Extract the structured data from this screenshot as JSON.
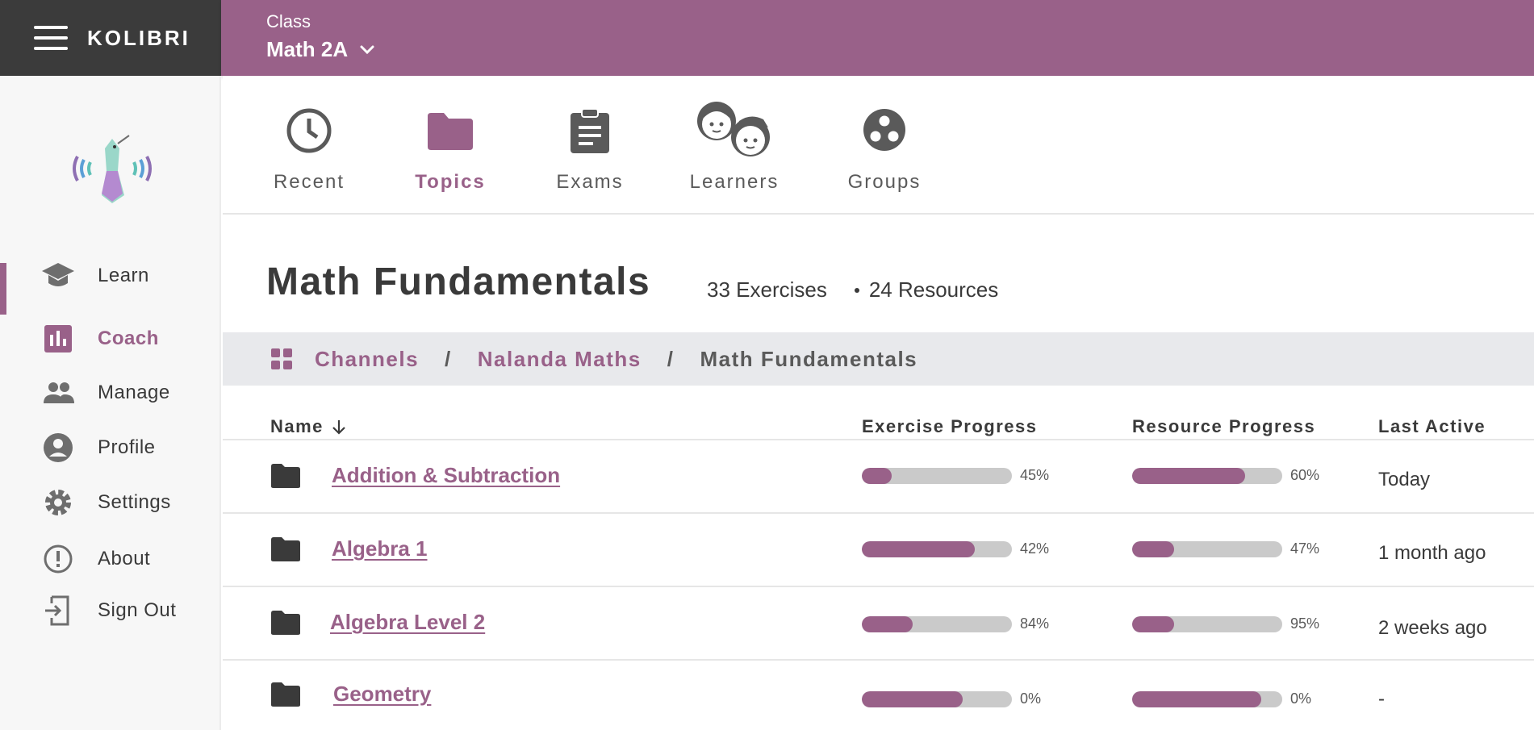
{
  "app": {
    "brand": "KOLIBRI"
  },
  "class": {
    "label": "Class",
    "name": "Math 2A"
  },
  "sidebar": {
    "items": [
      {
        "label": "Learn",
        "icon": "graduation-cap-icon"
      },
      {
        "label": "Coach",
        "icon": "bar-chart-icon",
        "active": true
      },
      {
        "label": "Manage",
        "icon": "people-icon"
      },
      {
        "label": "Profile",
        "icon": "person-circle-icon"
      },
      {
        "label": "Settings",
        "icon": "gear-icon"
      },
      {
        "label": "About",
        "icon": "exclamation-circle-icon"
      },
      {
        "label": "Sign Out",
        "icon": "logout-icon"
      }
    ]
  },
  "tabs": [
    {
      "label": "Recent",
      "icon": "clock-icon"
    },
    {
      "label": "Topics",
      "icon": "folder-icon",
      "active": true
    },
    {
      "label": "Exams",
      "icon": "clipboard-icon"
    },
    {
      "label": "Learners",
      "icon": "learners-faces-icon"
    },
    {
      "label": "Groups",
      "icon": "groups-icon"
    }
  ],
  "header": {
    "title": "Math Fundamentals",
    "exercises": "33 Exercises",
    "resources": "24 Resources"
  },
  "breadcrumb": {
    "root": "Channels",
    "channel": "Nalanda Maths",
    "current": "Math Fundamentals",
    "separator": "/"
  },
  "table": {
    "columns": {
      "name": "Name",
      "exercise_progress": "Exercise Progress",
      "resource_progress": "Resource Progress",
      "last_active": "Last Active"
    },
    "rows": [
      {
        "name": "Addition & Subtraction",
        "exercise_fill": 0.2,
        "exercise_pct": "45%",
        "resource_fill": 0.75,
        "resource_pct": "60%",
        "last_active": "Today"
      },
      {
        "name": "Algebra 1",
        "exercise_fill": 0.75,
        "exercise_pct": "42%",
        "resource_fill": 0.28,
        "resource_pct": "47%",
        "last_active": "1 month ago"
      },
      {
        "name": "Algebra Level 2",
        "exercise_fill": 0.34,
        "exercise_pct": "84%",
        "resource_fill": 0.28,
        "resource_pct": "95%",
        "last_active": "2 weeks ago"
      },
      {
        "name": "Geometry",
        "exercise_fill": 0.67,
        "exercise_pct": "0%",
        "resource_fill": 0.86,
        "resource_pct": "0%",
        "last_active": "-"
      }
    ]
  },
  "colors": {
    "accent": "#996189",
    "appbar_dark": "#3b3b3b",
    "bar_bg": "#cacaca"
  }
}
